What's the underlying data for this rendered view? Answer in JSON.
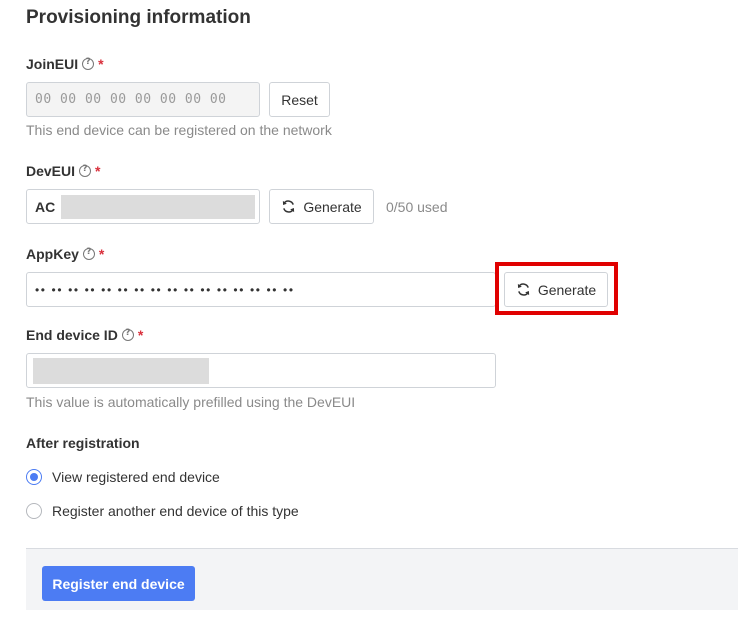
{
  "section_title": "Provisioning information",
  "join_eui": {
    "label": "JoinEUI",
    "required_mark": "*",
    "value": "00 00 00 00 00 00 00 00",
    "reset_label": "Reset",
    "hint": "This end device can be registered on the network"
  },
  "dev_eui": {
    "label": "DevEUI",
    "required_mark": "*",
    "value_prefix": "AC",
    "generate_label": "Generate",
    "usage": "0/50 used"
  },
  "app_key": {
    "label": "AppKey",
    "required_mark": "*",
    "masked_value": "•• •• •• •• •• •• •• •• •• •• •• •• •• •• •• ••",
    "generate_label": "Generate"
  },
  "end_device_id": {
    "label": "End device ID",
    "required_mark": "*",
    "hint": "This value is automatically prefilled using the DevEUI"
  },
  "after_registration": {
    "label": "After registration",
    "options": [
      {
        "label": "View registered end device",
        "selected": true
      },
      {
        "label": "Register another end device of this type",
        "selected": false
      }
    ]
  },
  "submit_label": "Register end device",
  "colors": {
    "accent": "#4c7cf3",
    "required": "#d9303c",
    "highlight": "#e00000"
  },
  "icons": {
    "help": "help-circle-icon",
    "refresh": "refresh-icon"
  }
}
